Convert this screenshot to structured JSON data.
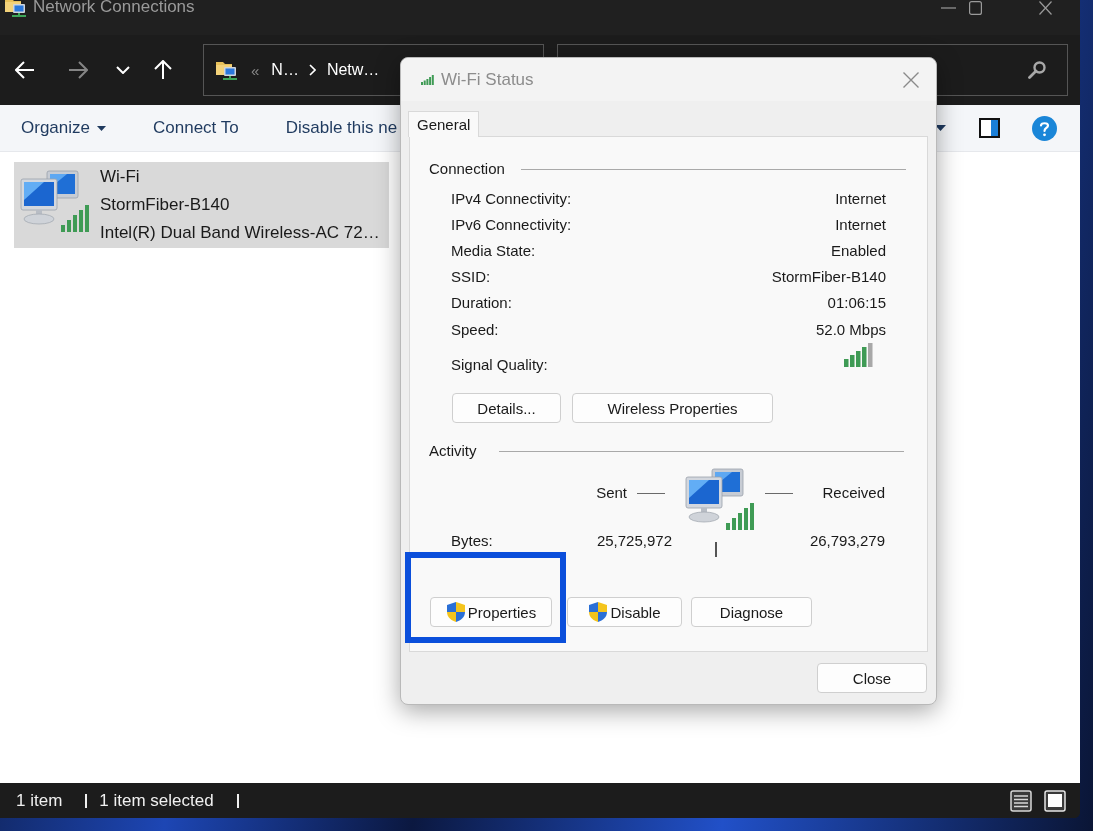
{
  "explorer": {
    "title": "Network Connections",
    "address": {
      "overflow": "«",
      "segments": [
        "N…",
        "Netw…"
      ]
    },
    "commands": [
      {
        "label": "Organize",
        "dropdown": true
      },
      {
        "label": "Connect To",
        "dropdown": false
      },
      {
        "label": "Disable this ne",
        "dropdown": false
      }
    ],
    "items": [
      {
        "name": "Wi-Fi",
        "network": "StormFiber-B140",
        "device": "Intel(R) Dual Band Wireless-AC 72…",
        "selected": true
      }
    ],
    "status_bar": {
      "item_count": "1 item",
      "selection": "1 item selected"
    }
  },
  "status_dialog": {
    "title": "Wi-Fi Status",
    "tabs": [
      {
        "label": "General",
        "selected": true
      }
    ],
    "connection": {
      "heading": "Connection",
      "rows": [
        {
          "label": "IPv4 Connectivity:",
          "value": "Internet"
        },
        {
          "label": "IPv6 Connectivity:",
          "value": "Internet"
        },
        {
          "label": "Media State:",
          "value": "Enabled"
        },
        {
          "label": "SSID:",
          "value": "StormFiber-B140"
        },
        {
          "label": "Duration:",
          "value": "01:06:15"
        },
        {
          "label": "Speed:",
          "value": "52.0 Mbps"
        }
      ],
      "signal_quality_label": "Signal Quality:",
      "buttons": [
        "Details...",
        "Wireless Properties"
      ]
    },
    "activity": {
      "heading": "Activity",
      "sent_label": "Sent",
      "received_label": "Received",
      "bytes_label": "Bytes:",
      "bytes_sent": "25,725,972",
      "bytes_received": "26,793,279",
      "buttons": [
        {
          "label": "Properties",
          "shield": true,
          "highlighted": true
        },
        {
          "label": "Disable",
          "shield": true,
          "highlighted": false
        },
        {
          "label": "Diagnose",
          "shield": false,
          "highlighted": false
        }
      ]
    },
    "close_button": "Close"
  }
}
